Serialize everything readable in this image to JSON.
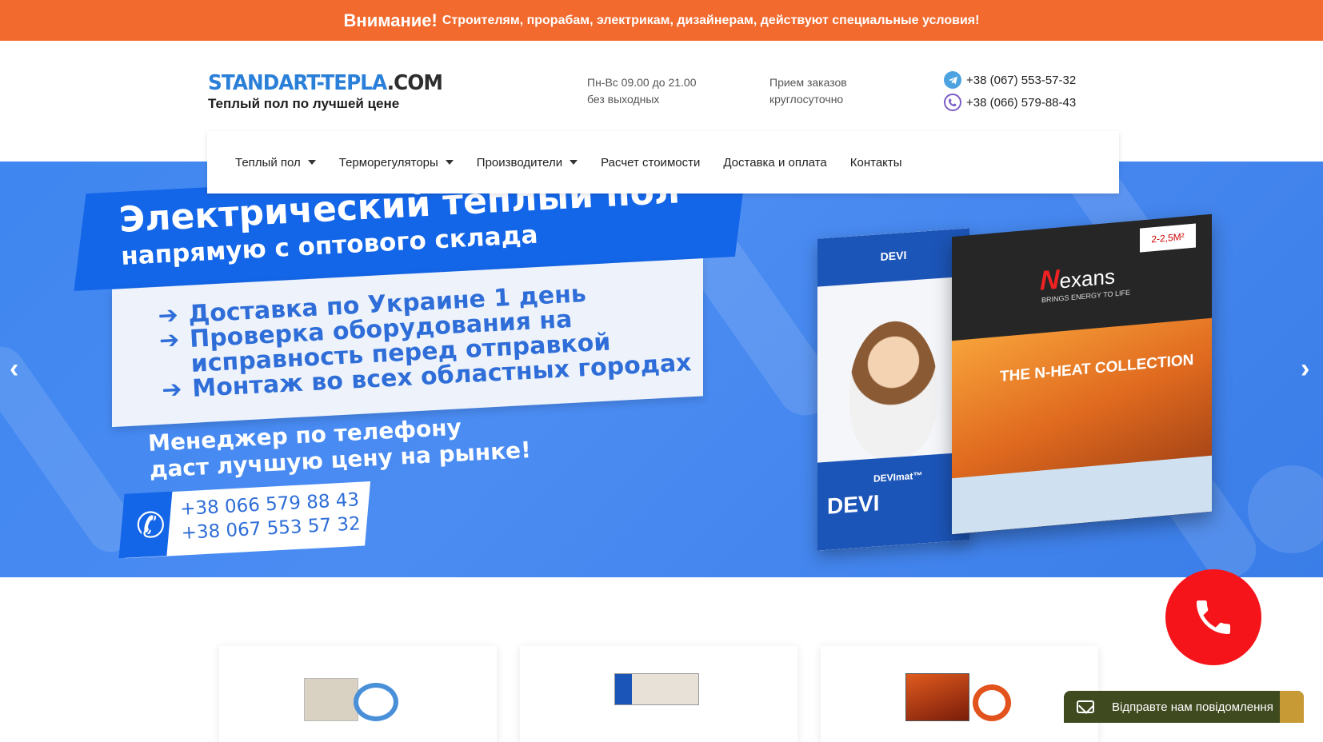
{
  "topbar": {
    "lead": "Внимание!",
    "text": "Строителям, прорабам, электрикам, дизайнерам, действуют специальные условия!"
  },
  "logo": {
    "name_main": "STANDART-TEPLA",
    "name_tld": ".COM",
    "slogan": "Теплый пол по лучшей цене"
  },
  "schedule": {
    "line1": "Пн-Вс 09.00 до 21.00",
    "line2": "без выходных"
  },
  "orders": {
    "line1": "Прием заказов",
    "line2": "круглосуточно"
  },
  "contacts": {
    "phone1": "+38 (067) 553-57-32",
    "phone1_icon": "telegram-icon",
    "phone2": "+38 (066) 579-88-43",
    "phone2_icon": "viber-icon"
  },
  "nav": {
    "items": [
      {
        "label": "Теплый пол",
        "dropdown": true
      },
      {
        "label": "Терморегуляторы",
        "dropdown": true
      },
      {
        "label": "Производители",
        "dropdown": true
      },
      {
        "label": "Расчет стоимости",
        "dropdown": false
      },
      {
        "label": "Доставка и оплата",
        "dropdown": false
      },
      {
        "label": "Контакты",
        "dropdown": false
      }
    ]
  },
  "hero": {
    "title_line1": "Электрический теплый пол",
    "title_line2": "напрямую с оптового склада",
    "bullet1": "Доставка по Украине 1 день",
    "bullet2a": "Проверка оборудования на",
    "bullet2b": "исправность  перед отправкой",
    "bullet3": "Монтаж во всех областных городах",
    "manager_line1": "Менеджер по телефону",
    "manager_line2": "даст лучшую цену на рынке!",
    "phone1": "+38 066 579 88 43",
    "phone2": "+38 067 553 57 32",
    "box_devi_top": "DEVI",
    "box_devi_bottom": "DEVI",
    "box_devi_product": "DEVImat™",
    "box_nexans_brand": "exans",
    "box_nexans_tagline": "BRINGS ENERGY TO LIFE",
    "box_nexans_collection": "THE N-HEAT COLLECTION",
    "box_nexans_sticker": "2-2,5M²",
    "prev_arrow": "‹",
    "next_arrow": "›"
  },
  "chat": {
    "label": "Відправте нам повідомлення"
  },
  "colors": {
    "topbar": "#f26a2e",
    "brand_blue": "#2a7fd8",
    "hero_blue": "#4b8cf2",
    "call_button": "#f5141a"
  }
}
